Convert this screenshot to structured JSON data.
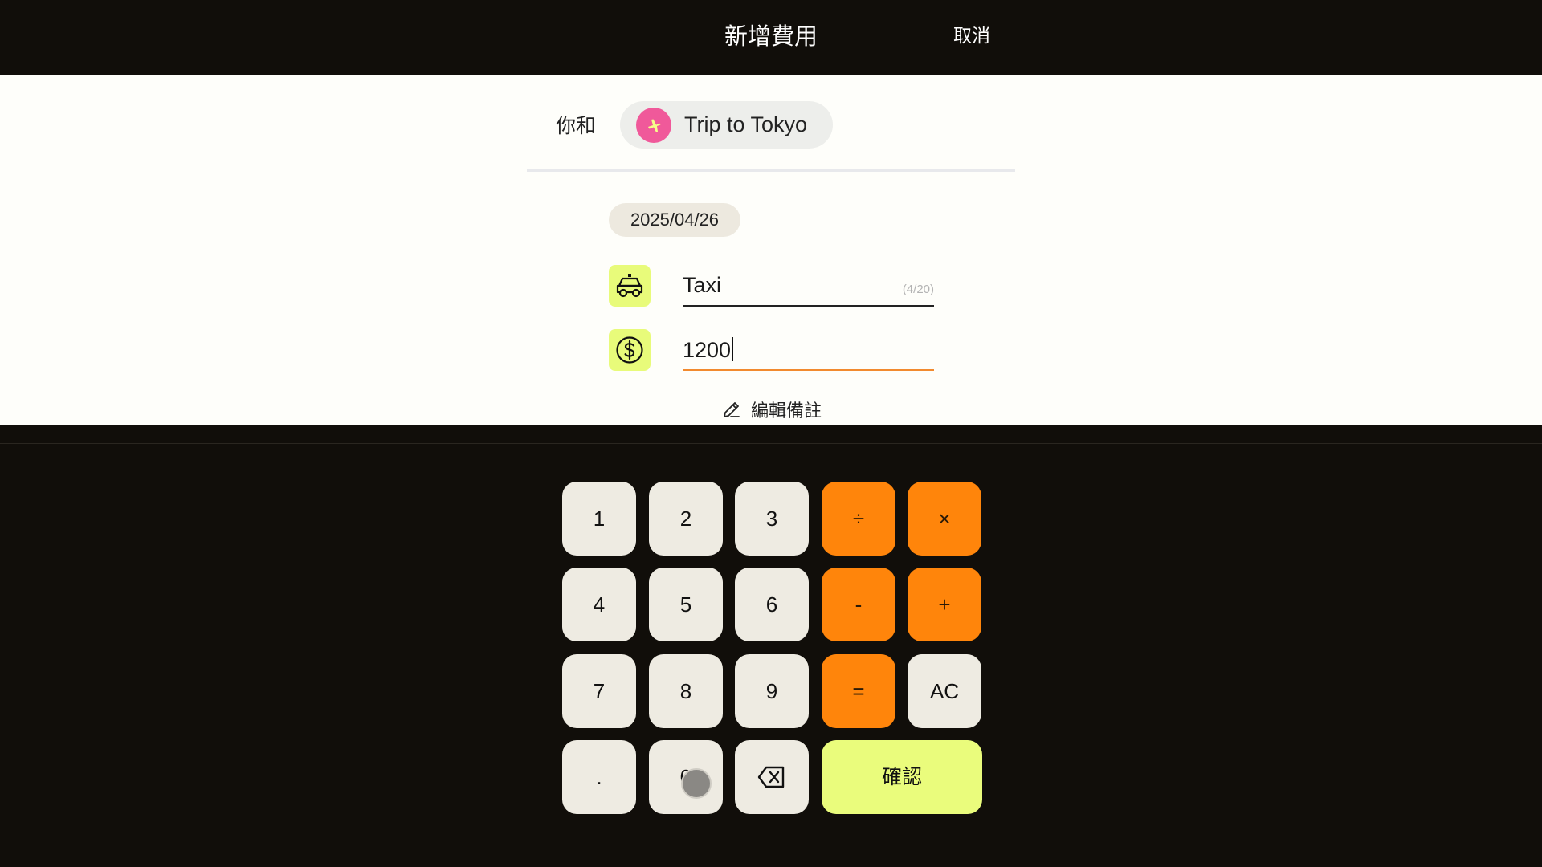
{
  "header": {
    "title": "新增費用",
    "cancel_label": "取消"
  },
  "group": {
    "with_label": "你和",
    "name": "Trip to Tokyo",
    "avatar_icon": "airplane-icon",
    "avatar_color": "#f0599a"
  },
  "expense": {
    "date": "2025/04/26",
    "category_icon": "taxi-icon",
    "description": "Taxi",
    "description_counter": "(4/20)",
    "amount_icon": "dollar-circle-icon",
    "amount": "1200",
    "note_label": "編輯備註"
  },
  "keypad": {
    "keys": [
      "1",
      "2",
      "3",
      "÷",
      "×",
      "4",
      "5",
      "6",
      "-",
      "+",
      "7",
      "8",
      "9",
      "=",
      "AC",
      ".",
      "0"
    ],
    "backspace_icon": "backspace-icon",
    "confirm_label": "確認"
  },
  "colors": {
    "accent_orange": "#ff850b",
    "accent_lime": "#eafc7c",
    "background_dark": "#110e0a"
  }
}
